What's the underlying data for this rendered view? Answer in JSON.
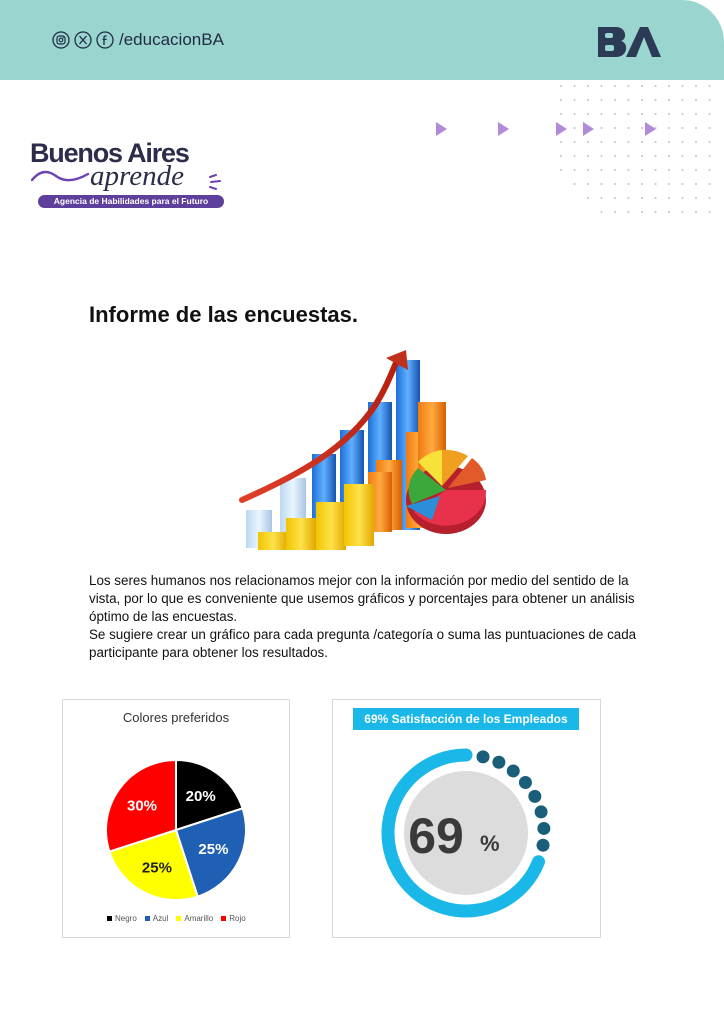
{
  "header": {
    "handle": "/educacionBA",
    "social_icons": [
      "instagram-icon",
      "x-icon",
      "facebook-icon"
    ],
    "ba_logo_text": "BA",
    "bg_color": "#9bd5d0"
  },
  "logo": {
    "title": "Buenos Aires",
    "subtitle": "aprende",
    "tagline": "Agencia de Habilidades para el Futuro"
  },
  "main": {
    "title": "Informe de las encuestas.",
    "paragraph1": "Los seres humanos nos relacionamos mejor con la información por medio del sentido de la vista, por lo que es conveniente que usemos gráficos y porcentajes para obtener un análisis óptimo de las encuestas.",
    "paragraph2": "Se sugiere crear un gráfico para cada pregunta /categoría o suma las puntuaciones de cada participante para obtener los resultados."
  },
  "chart_data": [
    {
      "type": "pie",
      "title": "Colores preferidos",
      "categories": [
        "Negro",
        "Azul",
        "Amarillo",
        "Rojo"
      ],
      "values": [
        20,
        25,
        25,
        30
      ],
      "labels": [
        "20%",
        "25%",
        "25%",
        "30%"
      ],
      "colors": [
        "#000000",
        "#1f5fb4",
        "#ffff00",
        "#ff0000"
      ],
      "legend": "bottom"
    },
    {
      "type": "gauge",
      "title": "69% Satisfacción de los Empleados",
      "value": 69,
      "value_number": "69",
      "unit": "%",
      "colors": [
        "#19b8e8",
        "#1a5e7a",
        "#dcdcdc"
      ]
    }
  ]
}
